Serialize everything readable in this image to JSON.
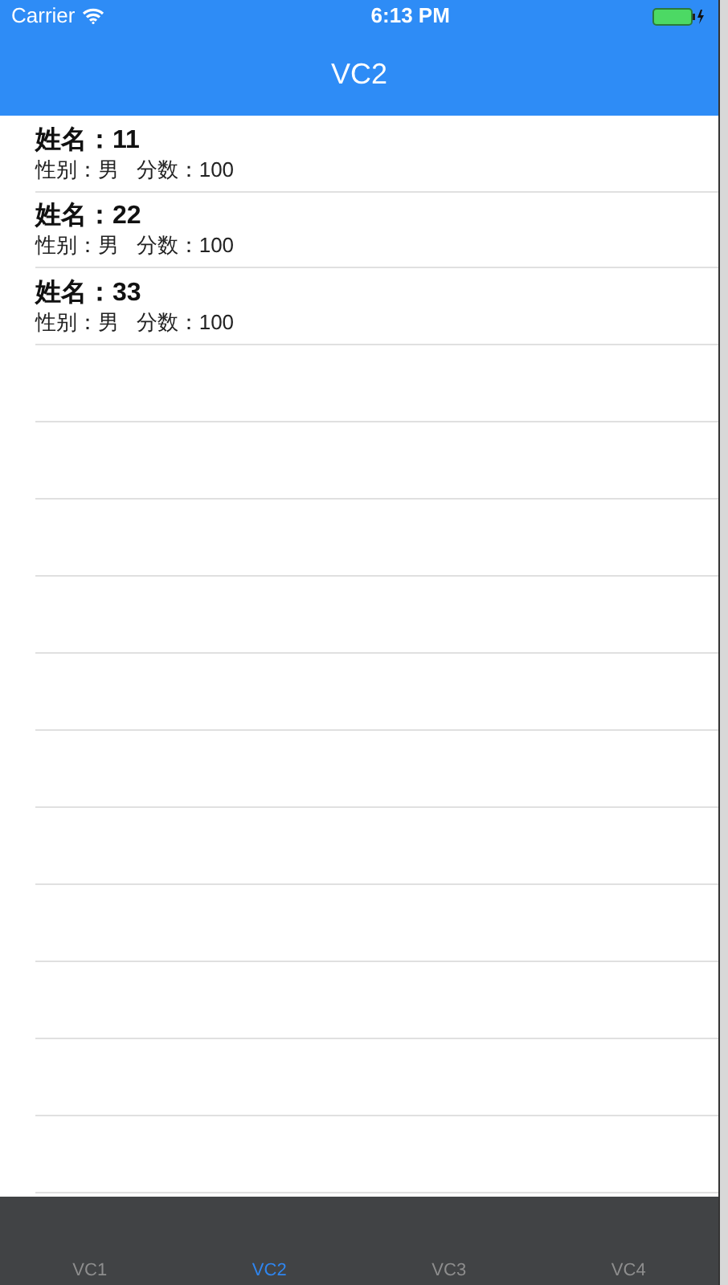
{
  "status_bar": {
    "carrier": "Carrier",
    "time": "6:13 PM"
  },
  "nav": {
    "title": "VC2"
  },
  "rows": [
    {
      "name": "姓名：11",
      "detail": "性别：男   分数：100"
    },
    {
      "name": "姓名：22",
      "detail": "性别：男   分数：100"
    },
    {
      "name": "姓名：33",
      "detail": "性别：男   分数：100"
    }
  ],
  "tabs": [
    {
      "label": "VC1",
      "selected": false
    },
    {
      "label": "VC2",
      "selected": true
    },
    {
      "label": "VC3",
      "selected": false
    },
    {
      "label": "VC4",
      "selected": false
    }
  ]
}
